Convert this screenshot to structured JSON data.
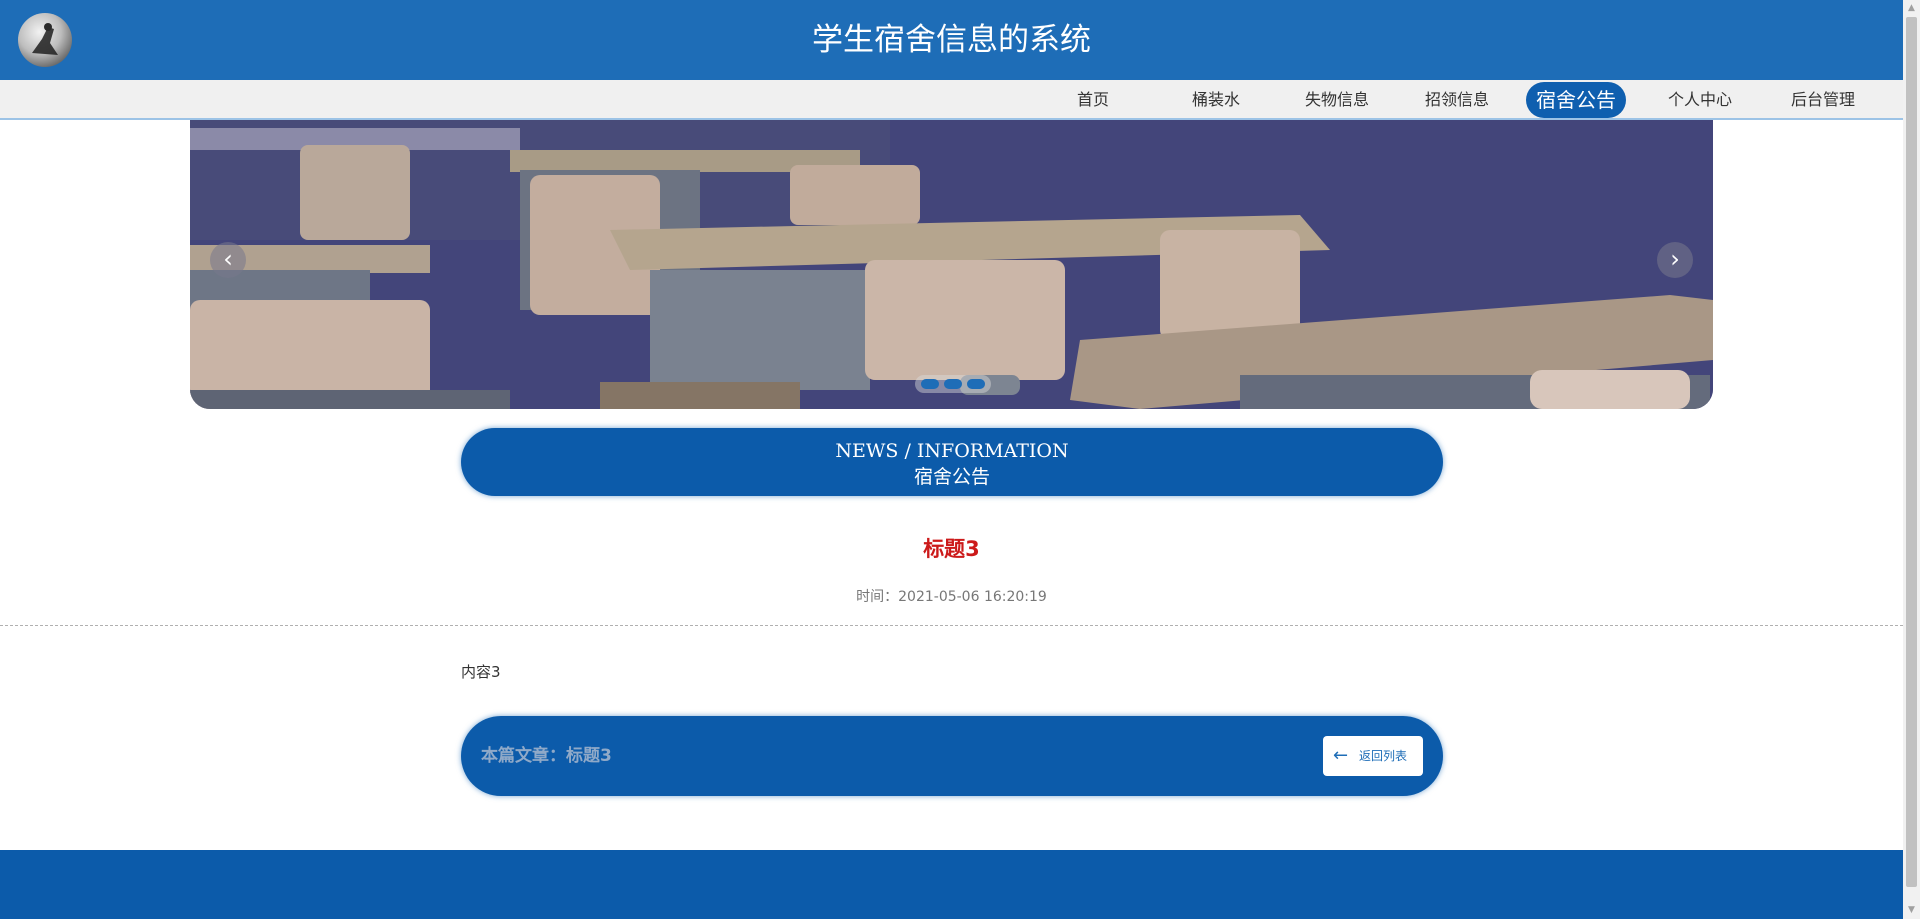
{
  "header": {
    "title": "学生宿舍信息的系统",
    "logo_icon": "avatar-logo"
  },
  "nav": {
    "items": [
      {
        "label": "首页"
      },
      {
        "label": "桶装水"
      },
      {
        "label": "失物信息"
      },
      {
        "label": "招领信息"
      },
      {
        "label": "宿舍公告",
        "active": true
      },
      {
        "label": "个人中心"
      },
      {
        "label": "后台管理"
      }
    ]
  },
  "banner": {
    "prev_icon": "chevron-left-icon",
    "next_icon": "chevron-right-icon",
    "slides": 3
  },
  "section": {
    "en": "NEWS / INFORMATION",
    "cn": "宿舍公告"
  },
  "article": {
    "title": "标题3",
    "time": "时间：2021-05-06 16:20:19",
    "content": "内容3"
  },
  "article_bar": {
    "label": "本篇文章：标题3",
    "back_label": "返回列表",
    "back_icon": "arrow-left-icon"
  },
  "colors": {
    "primary": "#1e6db7",
    "dark_blue": "#0c5baa",
    "title_red": "#cc1a1a"
  }
}
